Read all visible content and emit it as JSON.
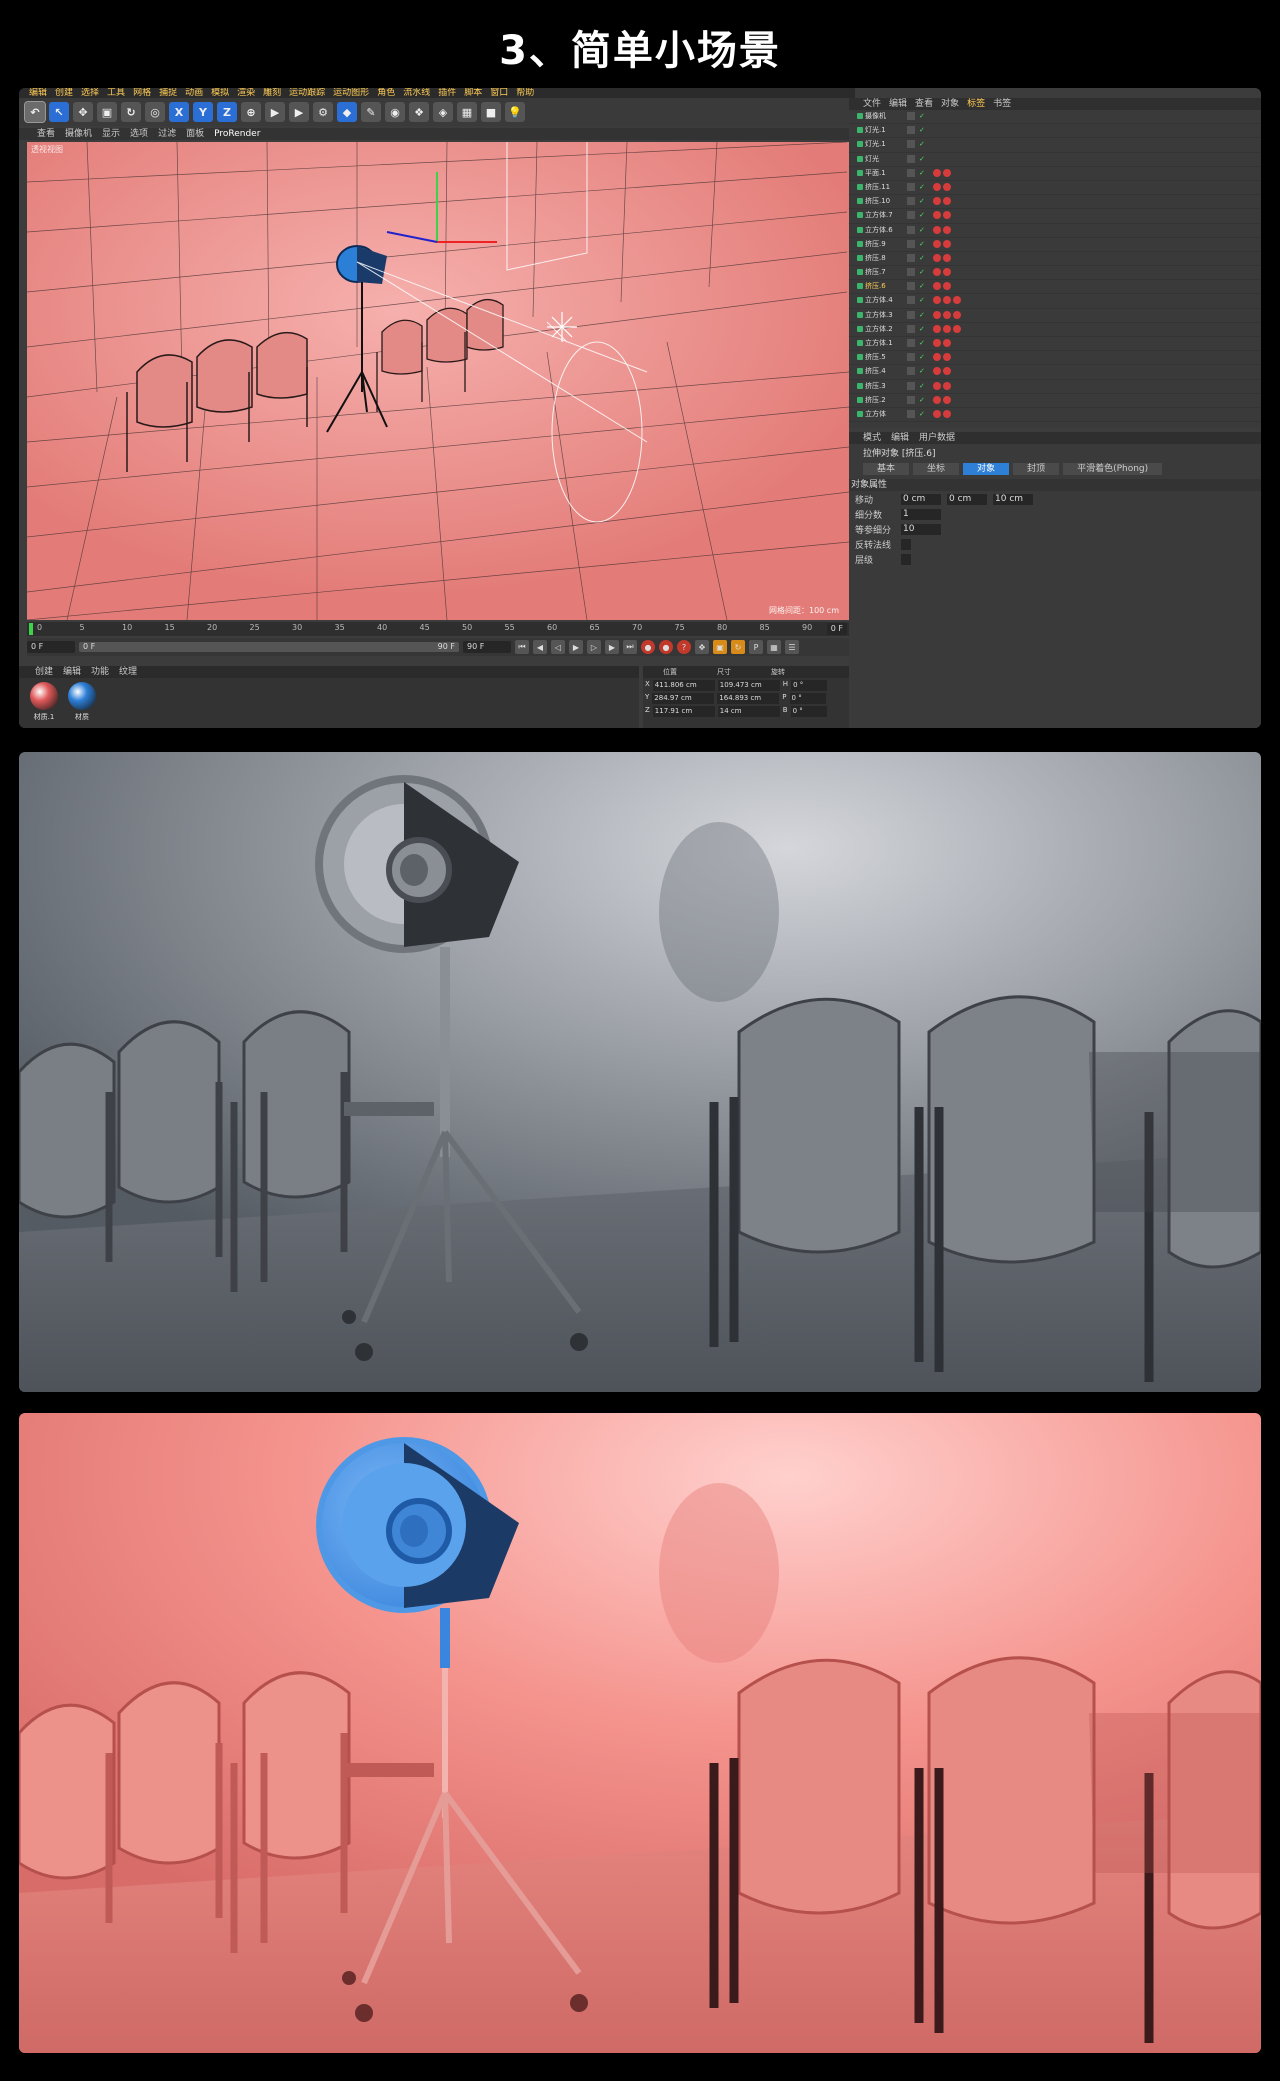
{
  "title": "3、简单小场景",
  "menubar": [
    "编辑",
    "创建",
    "选择",
    "工具",
    "网格",
    "捕捉",
    "动画",
    "模拟",
    "渲染",
    "雕刻",
    "运动跟踪",
    "运动图形",
    "角色",
    "流水线",
    "插件",
    "脚本",
    "窗口",
    "帮助"
  ],
  "toolbar_axes": [
    "X",
    "Y",
    "Z"
  ],
  "viewport_menu": [
    "查看",
    "摄像机",
    "显示",
    "选项",
    "过滤",
    "面板",
    "ProRender"
  ],
  "viewport": {
    "label": "透视视图",
    "grid_distance": "网格间距：100 cm"
  },
  "timeline": {
    "ticks": [
      "0",
      "5",
      "10",
      "15",
      "20",
      "25",
      "30",
      "35",
      "40",
      "45",
      "50",
      "55",
      "60",
      "65",
      "70",
      "75",
      "80",
      "85",
      "90"
    ],
    "end_field": "0 F"
  },
  "transport": {
    "start": "0 F",
    "current": "0 F",
    "slider_end": "90 F",
    "end": "90 F"
  },
  "materials": {
    "tabs": [
      "创建",
      "编辑",
      "功能",
      "纹理"
    ],
    "items": [
      {
        "name": "材质.1",
        "color": "#e0595a"
      },
      {
        "name": "材质",
        "color": "#2d7fd8"
      }
    ]
  },
  "coords": {
    "headers": [
      "位置",
      "尺寸",
      "旋转"
    ],
    "rows": [
      {
        "axis": "X",
        "pos": "411.806 cm",
        "size": "109.473 cm",
        "rot_axis": "H",
        "rot": "0 °"
      },
      {
        "axis": "Y",
        "pos": "284.97 cm",
        "size": "164.893 cm",
        "rot_axis": "P",
        "rot": "0 °"
      },
      {
        "axis": "Z",
        "pos": "117.91 cm",
        "size": "14 cm",
        "rot_axis": "B",
        "rot": "0 °"
      }
    ]
  },
  "object_manager": {
    "tabs": [
      "文件",
      "编辑",
      "查看",
      "对象",
      "标签",
      "书签"
    ],
    "active_tab": "标签",
    "rows": [
      {
        "name": "摄像机",
        "mat": 0
      },
      {
        "name": "灯光.1",
        "mat": 0
      },
      {
        "name": "灯光.1",
        "mat": 0
      },
      {
        "name": "灯光",
        "mat": 0
      },
      {
        "name": "平面.1",
        "mat": 2
      },
      {
        "name": "挤压.11",
        "mat": 2
      },
      {
        "name": "挤压.10",
        "mat": 2
      },
      {
        "name": "立方体.7",
        "mat": 2
      },
      {
        "name": "立方体.6",
        "mat": 2
      },
      {
        "name": "挤压.9",
        "mat": 2
      },
      {
        "name": "挤压.8",
        "mat": 2
      },
      {
        "name": "挤压.7",
        "mat": 2
      },
      {
        "name": "挤压.6",
        "mat": 2,
        "highlight": true
      },
      {
        "name": "立方体.4",
        "mat": 3
      },
      {
        "name": "立方体.3",
        "mat": 3
      },
      {
        "name": "立方体.2",
        "mat": 3
      },
      {
        "name": "立方体.1",
        "mat": 2
      },
      {
        "name": "挤压.5",
        "mat": 2
      },
      {
        "name": "挤压.4",
        "mat": 2
      },
      {
        "name": "挤压.3",
        "mat": 2
      },
      {
        "name": "挤压.2",
        "mat": 2
      },
      {
        "name": "立方体",
        "mat": 2
      }
    ]
  },
  "attributes": {
    "tabs": [
      "模式",
      "编辑",
      "用户数据"
    ],
    "object_title": "拉伸对象 [挤压.6]",
    "subtabs": [
      "基本",
      "坐标",
      "对象",
      "封顶",
      "平滑着色(Phong)"
    ],
    "active_subtab": "对象",
    "section": "对象属性",
    "fields": [
      {
        "label": "移动",
        "values": [
          "0 cm",
          "0 cm",
          "10 cm"
        ]
      },
      {
        "label": "细分数",
        "values": [
          "1"
        ]
      },
      {
        "label": "等参细分",
        "values": [
          "10"
        ]
      },
      {
        "label": "反转法线",
        "values": []
      },
      {
        "label": "层级",
        "values": []
      }
    ]
  },
  "colors": {
    "pink_bg": "#e88a86",
    "grey_bg": "#6b7078",
    "blue_light": "#4f98e6"
  }
}
